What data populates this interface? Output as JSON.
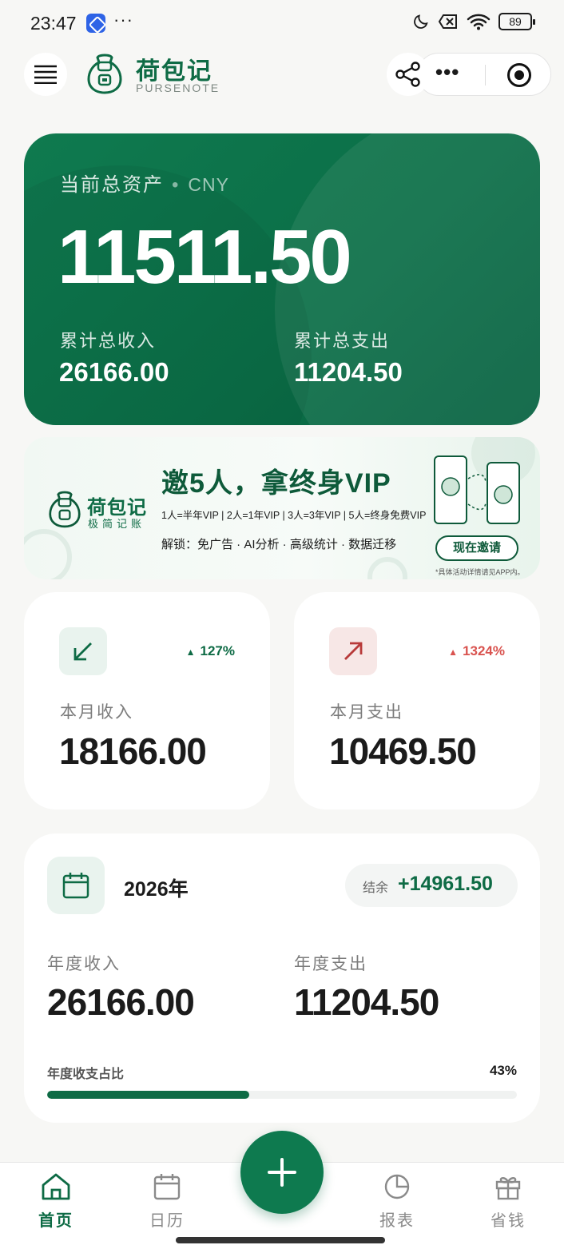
{
  "status_bar": {
    "time": "23:47",
    "dots": "···",
    "battery": "89"
  },
  "header": {
    "app_name": "荷包记",
    "app_subtitle": "PURSENOTE",
    "more": "•••"
  },
  "asset_card": {
    "label": "当前总资产",
    "currency": "CNY",
    "total": "11511.50",
    "income_label": "累计总收入",
    "income_value": "26166.00",
    "expense_label": "累计总支出",
    "expense_value": "11204.50"
  },
  "banner": {
    "brand": "荷包记",
    "slogan": "极简记账",
    "title": "邀5人，拿终身VIP",
    "tiers": "1人=半年VIP | 2人=1年VIP | 3人=3年VIP | 5人=终身免费VIP",
    "unlock": "解锁：免广告 · AI分析 · 高级统计 · 数据迁移",
    "button": "现在邀请",
    "note": "*具体活动详情请见APP内。"
  },
  "month": {
    "income": {
      "label": "本月收入",
      "value": "18166.00",
      "change": "127%",
      "color": "#0e6b45"
    },
    "expense": {
      "label": "本月支出",
      "value": "10469.50",
      "change": "1324%",
      "color": "#d9534f"
    }
  },
  "year": {
    "year": "2026年",
    "balance_label": "结余",
    "balance_value": "+14961.50",
    "income_label": "年度收入",
    "income_value": "26166.00",
    "expense_label": "年度支出",
    "expense_value": "11204.50",
    "ratio_label": "年度收支占比",
    "ratio_percent": "43%",
    "ratio_fraction": 0.43
  },
  "tabbar": {
    "home": "首页",
    "calendar": "日历",
    "reports": "报表",
    "save": "省钱"
  },
  "colors": {
    "brand": "#0e6b45",
    "expense": "#d9534f"
  }
}
